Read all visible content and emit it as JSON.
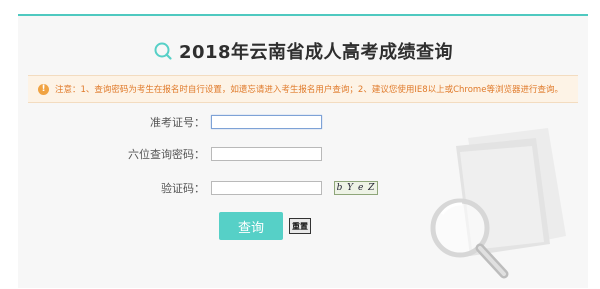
{
  "page": {
    "title": "2018年云南省成人高考成绩查询",
    "notice": "注意：1、查询密码为考生在报名时自行设置，如遗忘请进入考生报名用户查询；2、建议您使用IE8以上或Chrome等浏览器进行查询。"
  },
  "form": {
    "ticket_label": "准考证号：",
    "ticket_value": "",
    "password_label": "六位查询密码：",
    "password_value": "",
    "captcha_label": "验证码：",
    "captcha_value": "",
    "captcha_text": "b Y e Z"
  },
  "buttons": {
    "query": "查询",
    "reset": "重置"
  },
  "colors": {
    "accent": "#56d0c7",
    "notice_text": "#e07a2a",
    "warning_icon": "#f0a343"
  },
  "icons": {
    "title": "search-icon",
    "notice": "warning-icon",
    "decor": "magnifier-folder-icon"
  }
}
